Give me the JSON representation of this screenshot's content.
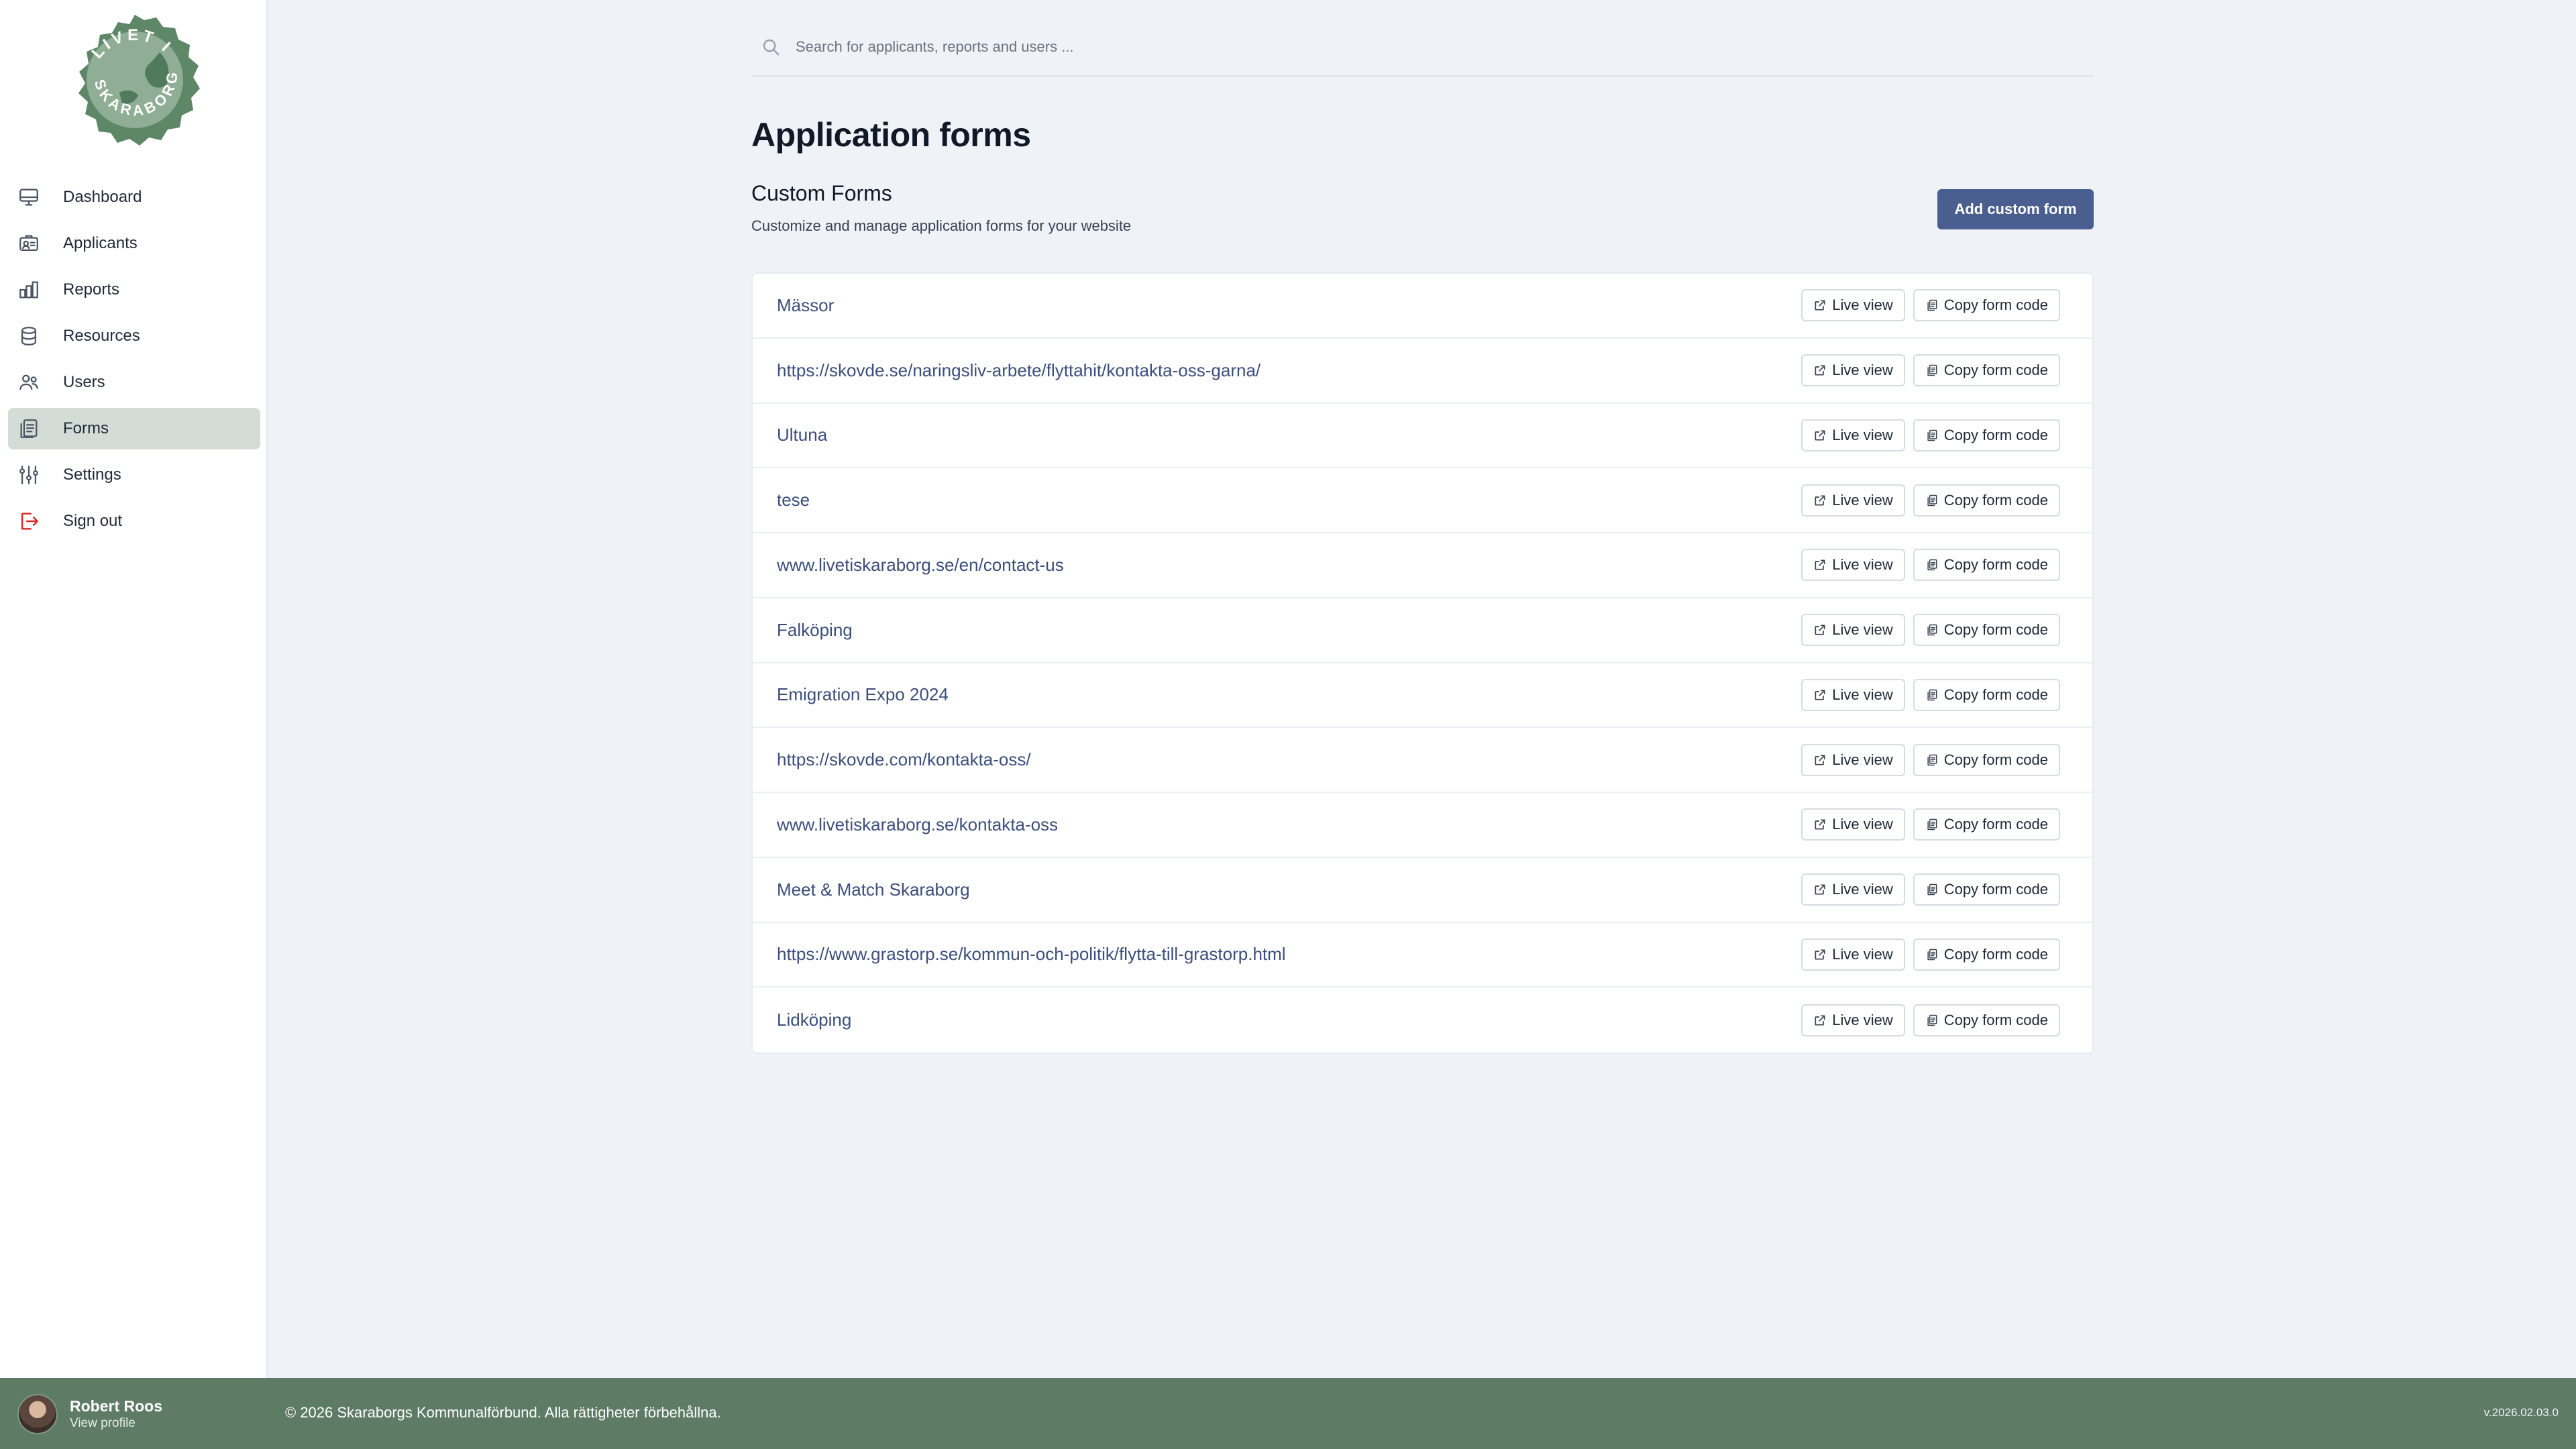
{
  "logo": {
    "top_text": "LIVET I",
    "bottom_text": "SKARABORG"
  },
  "sidebar": {
    "items": [
      {
        "label": "Dashboard",
        "icon": "monitor-icon",
        "active": false
      },
      {
        "label": "Applicants",
        "icon": "id-card-icon",
        "active": false
      },
      {
        "label": "Reports",
        "icon": "bar-chart-icon",
        "active": false
      },
      {
        "label": "Resources",
        "icon": "database-icon",
        "active": false
      },
      {
        "label": "Users",
        "icon": "users-icon",
        "active": false
      },
      {
        "label": "Forms",
        "icon": "clipboard-icon",
        "active": true
      },
      {
        "label": "Settings",
        "icon": "sliders-icon",
        "active": false
      },
      {
        "label": "Sign out",
        "icon": "sign-out-icon",
        "active": false
      }
    ]
  },
  "search": {
    "placeholder": "Search for applicants, reports and users ...",
    "value": ""
  },
  "page": {
    "title": "Application forms",
    "section_title": "Custom Forms",
    "section_description": "Customize and manage application forms for your website",
    "add_button": "Add custom form"
  },
  "row_buttons": {
    "live_view": "Live view",
    "copy_code": "Copy form code"
  },
  "forms": [
    "Mässor",
    "https://skovde.se/naringsliv-arbete/flyttahit/kontakta-oss-garna/",
    "Ultuna",
    "tese",
    "www.livetiskaraborg.se/en/contact-us",
    "Falköping",
    "Emigration Expo 2024",
    "https://skovde.com/kontakta-oss/",
    "www.livetiskaraborg.se/kontakta-oss",
    "Meet & Match Skaraborg",
    "https://www.grastorp.se/kommun-och-politik/flytta-till-grastorp.html",
    "Lidköping"
  ],
  "footer": {
    "user_name": "Robert Roos",
    "profile_link": "View profile",
    "copyright": "© 2026 Skaraborgs Kommunalförbund. Alla rättigheter förbehållna.",
    "version": "v.2026.02.03.0"
  },
  "colors": {
    "accent": "#4a5e8f",
    "brand_green": "#5e7b66",
    "active_nav": "#d3ddd5",
    "page_bg": "#eff3f8",
    "link": "#3b4e7c",
    "sign_out": "#dc2626"
  }
}
